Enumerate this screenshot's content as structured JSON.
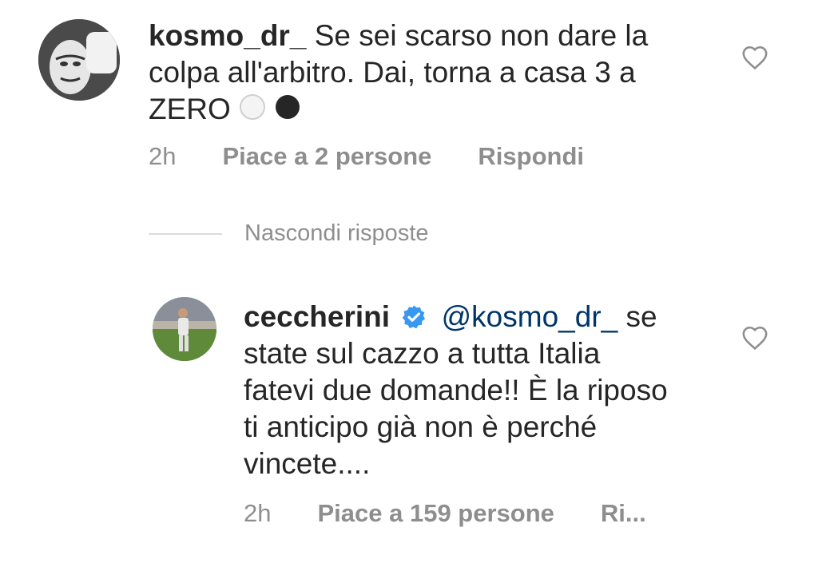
{
  "comment": {
    "username": "kosmo_dr_",
    "text_lines": [
      "Se sei scarso non dare la",
      "colpa all'arbitro. Dai, torna a casa 3 a",
      "ZERO"
    ],
    "time": "2h",
    "likes": "Piace a 2 persone",
    "reply": "Rispondi"
  },
  "toggle": {
    "label": "Nascondi risposte"
  },
  "reply": {
    "username": "ceccherini",
    "mention": "@kosmo_dr_",
    "text_lines": [
      "se",
      "state sul cazzo a tutta Italia",
      "fatevi due domande!! È la riposo",
      "ti anticipo già non è perché",
      "vincete...."
    ],
    "time": "2h",
    "likes": "Piace a 159 persone",
    "reply": "Ri..."
  },
  "colors": {
    "mention": "#003569",
    "verified": "#3897f0",
    "muted": "#8e8e8e"
  },
  "icons": [
    "heart-icon",
    "verified-badge-icon",
    "white-circle-emoji",
    "black-circle-emoji"
  ]
}
